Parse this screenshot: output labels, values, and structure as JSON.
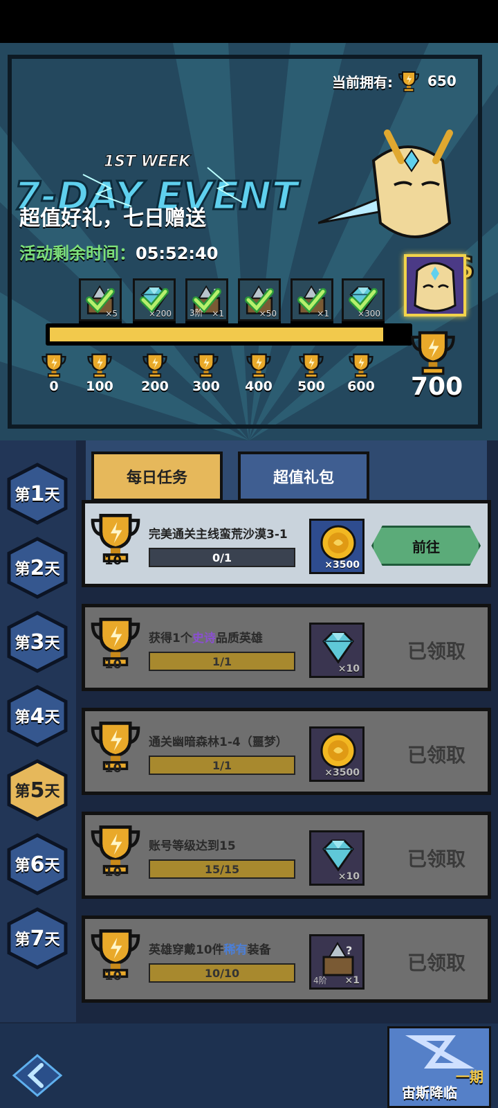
{
  "banner": {
    "owned_label": "当前拥有:",
    "owned_value": "650",
    "event_logo_week": "1ST WEEK",
    "event_logo_title": "7-DAY EVENT",
    "slogan": "超值好礼，七日赠送",
    "timer_label": "活动剩余时间：",
    "timer_value": "05:52:40",
    "hero_grade": "S",
    "milestone_rewards": [
      {
        "icon": "equipment-chest-icon",
        "qty": "×5",
        "tier": ""
      },
      {
        "icon": "diamond-icon",
        "qty": "×200",
        "tier": ""
      },
      {
        "icon": "armor-chest-icon",
        "qty": "×1",
        "tier": "3阶"
      },
      {
        "icon": "treasure-chest-icon",
        "qty": "×50",
        "tier": ""
      },
      {
        "icon": "magic-chest-icon",
        "qty": "×1",
        "tier": ""
      },
      {
        "icon": "diamond-icon",
        "qty": "×300",
        "tier": ""
      }
    ],
    "ticks": [
      "0",
      "100",
      "200",
      "300",
      "400",
      "500",
      "600"
    ],
    "goal": "700",
    "progress_fraction": 0.93
  },
  "days": [
    {
      "prefix": "第",
      "num": "1",
      "suffix": "天"
    },
    {
      "prefix": "第",
      "num": "2",
      "suffix": "天"
    },
    {
      "prefix": "第",
      "num": "3",
      "suffix": "天"
    },
    {
      "prefix": "第",
      "num": "4",
      "suffix": "天"
    },
    {
      "prefix": "第",
      "num": "5",
      "suffix": "天"
    },
    {
      "prefix": "第",
      "num": "6",
      "suffix": "天"
    },
    {
      "prefix": "第",
      "num": "7",
      "suffix": "天"
    }
  ],
  "active_day_index": 4,
  "tabs": {
    "daily": "每日任务",
    "gift": "超值礼包"
  },
  "tasks": [
    {
      "points": "10",
      "title": "完美通关主线蛮荒沙漠3-1",
      "progress": "0/1",
      "reward_icon": "gold-coin-icon",
      "reward_qty": "×3500",
      "action": "前往",
      "status": "open"
    },
    {
      "points": "10",
      "title_a": "获得1个",
      "title_b": "史诗",
      "title_c": "品质英雄",
      "progress": "1/1",
      "reward_icon": "diamond-icon",
      "reward_qty": "×10",
      "action": "已领取",
      "status": "claimed"
    },
    {
      "points": "10",
      "title": "通关幽暗森林1-4（噩梦）",
      "progress": "1/1",
      "reward_icon": "gold-coin-icon",
      "reward_qty": "×3500",
      "action": "已领取",
      "status": "claimed"
    },
    {
      "points": "10",
      "title": "账号等级达到15",
      "progress": "15/15",
      "reward_icon": "diamond-icon",
      "reward_qty": "×10",
      "action": "已领取",
      "status": "claimed"
    },
    {
      "points": "10",
      "title_a": "英雄穿戴10件",
      "title_b": "稀有",
      "title_c": "装备",
      "progress": "10/10",
      "reward_icon": "armor-chest-icon",
      "reward_qty": "×1",
      "reward_tier": "4阶",
      "action": "已领取",
      "status": "claimed"
    }
  ],
  "footer": {
    "event_label": "宙斯降临",
    "event_period": "一期"
  },
  "colors": {
    "accent_gold": "#f2c94c",
    "go_green": "#5bab79",
    "epic": "#8a4fd0",
    "rare": "#4b7fd8"
  }
}
